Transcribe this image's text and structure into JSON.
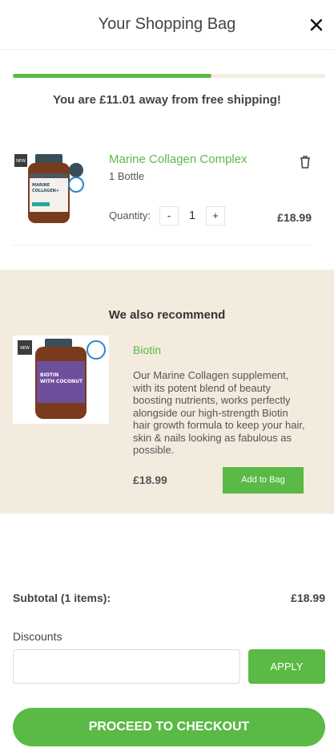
{
  "header": {
    "title": "Your Shopping Bag",
    "close_icon": "close-icon"
  },
  "shipping": {
    "message": "You are £11.01 away from free shipping!",
    "progress": 0.635
  },
  "cart_item": {
    "name": "Marine Collagen Complex",
    "variant": "1 Bottle",
    "quantity_label": "Quantity:",
    "quantity": "1",
    "minus": "-",
    "plus": "+",
    "price": "£18.99",
    "product_label_line1": "MARINE",
    "product_label_line2": "COLLAGEN+",
    "badge": "NEW"
  },
  "recommend": {
    "heading": "We also recommend",
    "name": "Biotin",
    "description": "Our Marine Collagen supplement, with its potent blend of beauty boosting nutrients, works perfectly alongside our high-strength Biotin hair growth formula to keep your hair, skin & nails looking as fabulous as possible.",
    "price": "£18.99",
    "add_button": "Add to Bag",
    "product_label_line1": "BIOTIN",
    "product_label_line2": "WITH COCONUT",
    "badge": "NEW"
  },
  "summary": {
    "subtotal_label": "Subtotal (1 items):",
    "subtotal_value": "£18.99",
    "discounts_label": "Discounts",
    "discount_placeholder": "",
    "apply_button": "APPLY",
    "checkout_button": "PROCEED TO CHECKOUT"
  },
  "colors": {
    "accent": "#5bb946",
    "recommend_bg": "#f3ebde",
    "track": "#f3eee2"
  }
}
